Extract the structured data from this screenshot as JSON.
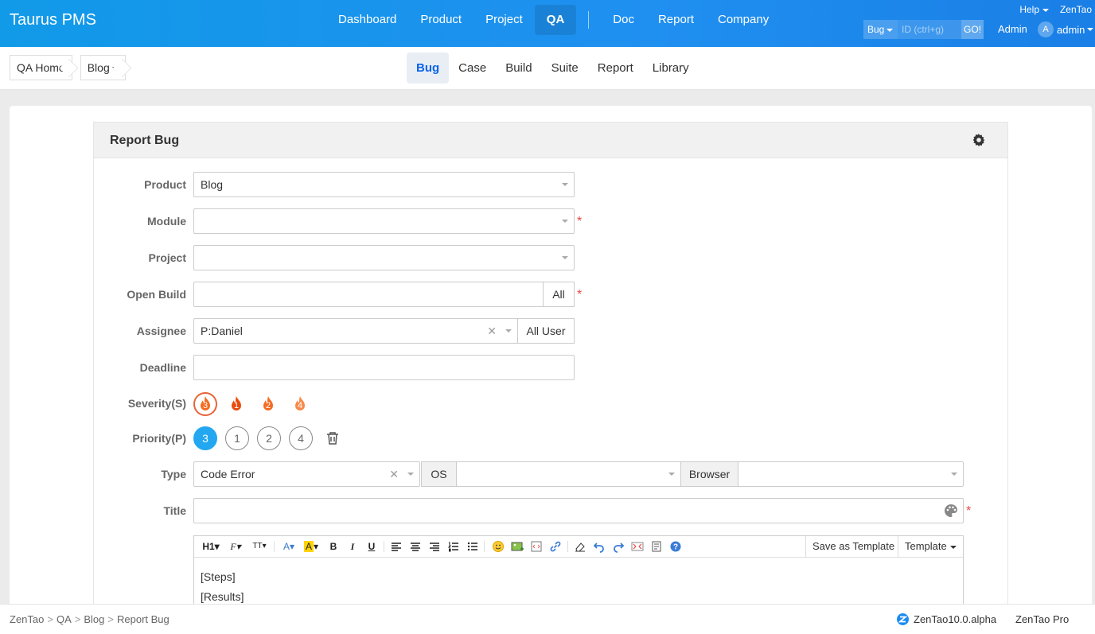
{
  "app": {
    "brand": "Taurus PMS"
  },
  "main_nav": {
    "items": [
      {
        "label": "Dashboard"
      },
      {
        "label": "Product"
      },
      {
        "label": "Project"
      },
      {
        "label": "QA",
        "active": true
      },
      {
        "label": "Doc"
      },
      {
        "label": "Report"
      },
      {
        "label": "Company"
      }
    ]
  },
  "top_right": {
    "help": "Help",
    "zentao": "ZenTao",
    "search_type": "Bug",
    "search_placeholder": "ID (ctrl+g)",
    "search_go": "GO!",
    "admin_link": "Admin",
    "avatar_letter": "A",
    "user_name": "admin"
  },
  "breadcrumb": {
    "home": "QA Home",
    "product": "Blog"
  },
  "sub_nav": {
    "items": [
      {
        "label": "Bug",
        "active": true
      },
      {
        "label": "Case"
      },
      {
        "label": "Build"
      },
      {
        "label": "Suite"
      },
      {
        "label": "Report"
      },
      {
        "label": "Library"
      }
    ]
  },
  "form": {
    "title": "Report Bug",
    "labels": {
      "product": "Product",
      "module": "Module",
      "project": "Project",
      "open_build": "Open Build",
      "assignee": "Assignee",
      "deadline": "Deadline",
      "severity": "Severity(S)",
      "priority": "Priority(P)",
      "type": "Type",
      "title": "Title"
    },
    "values": {
      "product": "Blog",
      "module": "",
      "project": "",
      "open_build": "",
      "assignee": "P:Daniel",
      "deadline": "",
      "type": "Code Error",
      "os": "",
      "browser": "",
      "title": ""
    },
    "addons": {
      "open_build_all": "All",
      "assignee_all_user": "All User",
      "os": "OS",
      "browser": "Browser"
    },
    "required_mark": "*",
    "clear_glyph": "✕",
    "severity_options": [
      "3",
      "1",
      "2",
      "4"
    ],
    "severity_selected": "3",
    "priority_options": [
      "3",
      "1",
      "2",
      "4"
    ],
    "priority_selected": "3",
    "colors": {
      "accent": "#22a7f0",
      "severity_1": "#e84d0e",
      "severity_2": "#f36c22",
      "severity_3": "#f36c22",
      "severity_4": "#f88a4b",
      "required": "#ee4444"
    }
  },
  "editor": {
    "toolbar": {
      "heading": "H1",
      "font_family": "F",
      "font_size": "TT",
      "bold": "B",
      "italic": "I",
      "underline": "U",
      "save_template": "Save as Template",
      "template": "Template"
    },
    "content_lines": [
      "[Steps]",
      "[Results]"
    ]
  },
  "footer": {
    "crumbs": [
      "ZenTao",
      "QA",
      "Blog",
      "Report Bug"
    ],
    "crumb_separator": ">",
    "version": "ZenTao10.0.alpha",
    "pro": "ZenTao Pro"
  }
}
